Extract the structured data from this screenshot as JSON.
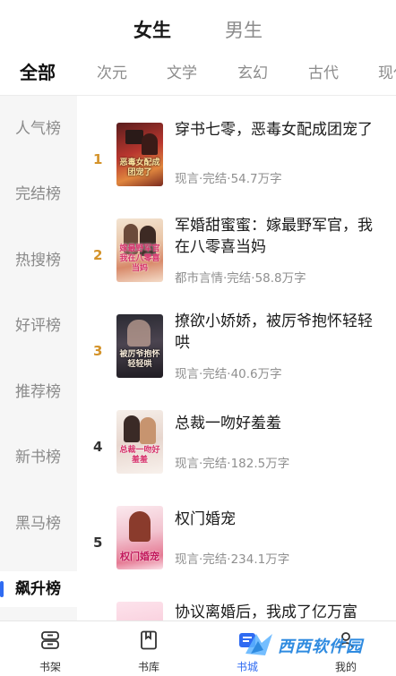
{
  "gender_tabs": [
    {
      "label": "女生",
      "active": true
    },
    {
      "label": "男生",
      "active": false
    }
  ],
  "category_tabs": [
    "全部",
    "次元",
    "文学",
    "玄幻",
    "古代",
    "现代"
  ],
  "active_category": "全部",
  "sidebar": {
    "items": [
      "人气榜",
      "完结榜",
      "热搜榜",
      "好评榜",
      "推荐榜",
      "新书榜",
      "黑马榜",
      "飙升榜"
    ],
    "active": "飙升榜"
  },
  "books": [
    {
      "rank": "1",
      "title": "穿书七零，恶毒女配成团宠了",
      "meta": "现言·完结·54.7万字",
      "cover_text": "恶毒女配成团宠了",
      "rank_color": "#d4932a"
    },
    {
      "rank": "2",
      "title": "军婚甜蜜蜜：嫁最野军官，我在八零喜当妈",
      "meta": "都市言情·完结·58.8万字",
      "cover_text": "嫁最野军官我在八零喜当妈",
      "rank_color": "#d4932a"
    },
    {
      "rank": "3",
      "title": "撩欲小娇娇，被厉爷抱怀轻轻哄",
      "meta": "现言·完结·40.6万字",
      "cover_text": "被厉爷抱怀轻轻哄",
      "rank_color": "#d4932a"
    },
    {
      "rank": "4",
      "title": "总裁一吻好羞羞",
      "meta": "现言·完结·182.5万字",
      "cover_text": "总裁一吻好羞羞",
      "rank_color": "#333333"
    },
    {
      "rank": "5",
      "title": "权门婚宠",
      "meta": "现言·完结·234.1万字",
      "cover_text": "权门婚宠",
      "rank_color": "#333333"
    },
    {
      "rank": "",
      "title": "协议离婚后，我成了亿万富",
      "meta": "",
      "cover_text": "",
      "rank_color": "#333333"
    }
  ],
  "bottom_nav": [
    {
      "label": "书架",
      "icon": "bookshelf-icon",
      "active": false
    },
    {
      "label": "书库",
      "icon": "book-icon",
      "active": false
    },
    {
      "label": "书城",
      "icon": "bookstore-icon",
      "active": true
    },
    {
      "label": "我的",
      "icon": "profile-icon",
      "active": false
    }
  ],
  "watermark": "西西软件园",
  "colors": {
    "accent": "#2f6bf2",
    "rank_top": "#d4932a",
    "muted_text": "#8c8c8c",
    "sidebar_bg": "#f6f6f6"
  }
}
